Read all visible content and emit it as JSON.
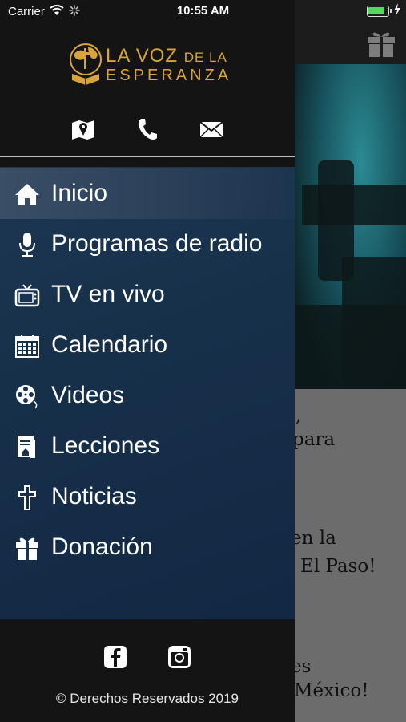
{
  "status_bar": {
    "carrier": "Carrier",
    "time": "10:55 AM"
  },
  "logo": {
    "line1": "LA VOZ",
    "line1_small": "DE LA",
    "line2": "ESPERANZA"
  },
  "contact_icons": [
    "map-icon",
    "phone-icon",
    "mail-icon"
  ],
  "menu": {
    "items": [
      {
        "label": "Inicio",
        "icon": "home-icon",
        "active": true
      },
      {
        "label": "Programas de radio",
        "icon": "microphone-icon"
      },
      {
        "label": "TV en vivo",
        "icon": "tv-icon"
      },
      {
        "label": "Calendario",
        "icon": "calendar-icon"
      },
      {
        "label": "Videos",
        "icon": "film-reel-icon"
      },
      {
        "label": "Lecciones",
        "icon": "lessons-icon"
      },
      {
        "label": "Noticias",
        "icon": "cross-icon"
      },
      {
        "label": "Donación",
        "icon": "gift-icon"
      }
    ]
  },
  "footer": {
    "social_icons": [
      "facebook-icon",
      "instagram-icon"
    ],
    "copyright": "© Derechos Reservados 2019"
  },
  "background_text": {
    "lines": [
      ",",
      "para",
      "en la",
      "El Paso!",
      "es",
      "México!"
    ]
  },
  "colors": {
    "accent_gold": "#d9a53a",
    "menu_blue": "#17304a",
    "battery_green": "#4cd964"
  }
}
